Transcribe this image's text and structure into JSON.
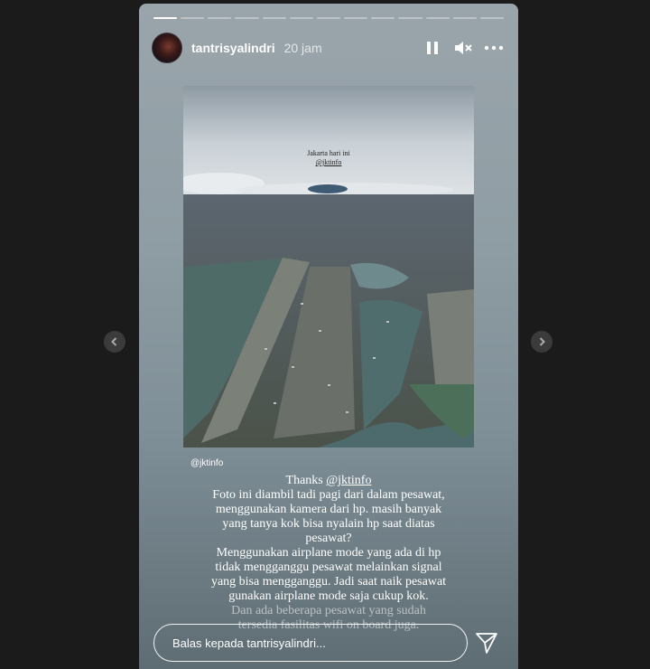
{
  "story": {
    "username": "tantrisyalindri",
    "timestamp": "20 jam",
    "progress": {
      "total_segments": 13,
      "current_index": 0
    }
  },
  "photo": {
    "overlay_line1": "Jakarta hari ini",
    "overlay_line2": "@jktinfo",
    "credit": "@jktinfo"
  },
  "caption": {
    "thanks_prefix": "Thanks ",
    "thanks_mention": "@jktinfo",
    "lines": [
      "Foto ini diambil tadi pagi dari dalam pesawat,",
      "menggunakan kamera dari hp. masih banyak",
      "yang tanya kok bisa nyalain hp saat diatas",
      "pesawat?",
      "Menggunakan airplane mode yang ada di hp",
      "tidak mengganggu pesawat melainkan signal",
      "yang bisa mengganggu. Jadi saat naik pesawat",
      "gunakan airplane mode saja cukup kok."
    ],
    "faded_lines": [
      "Dan ada beberapa pesawat yang sudah",
      "tersedia fasilitas wifi on board juga."
    ]
  },
  "reply": {
    "placeholder": "Balas kepada tantrisyalindri..."
  },
  "icons": {
    "pause": "pause-icon",
    "mute": "speaker-muted-icon",
    "more": "more-horizontal-icon",
    "send": "send-paper-plane-icon",
    "prev": "chevron-left-icon",
    "next": "chevron-right-icon"
  },
  "colors": {
    "page_bg": "#1b1b1b",
    "story_top": "#9aa5ab",
    "story_bottom": "#5e6c73",
    "text": "#ffffff"
  }
}
